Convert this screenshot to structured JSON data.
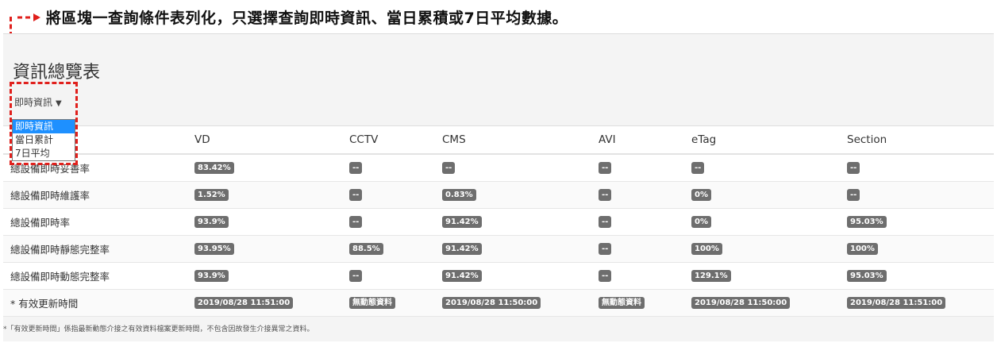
{
  "annotation": {
    "text": "將區塊一查詢條件表列化，只選擇查詢即時資訊、當日累積或7日平均數據。",
    "color": "#e0201c"
  },
  "panel": {
    "title": "資訊總覽表",
    "select": {
      "value": "即時資訊",
      "options": [
        "即時資訊",
        "當日累計",
        "7日平均"
      ]
    }
  },
  "table": {
    "columns": [
      "",
      "VD",
      "CCTV",
      "CMS",
      "AVI",
      "eTag",
      "Section"
    ],
    "rows": [
      {
        "label": "總設備即時妥善率",
        "values": [
          "83.42%",
          "--",
          "--",
          "--",
          "--",
          "--"
        ]
      },
      {
        "label": "總設備即時維護率",
        "values": [
          "1.52%",
          "--",
          "0.83%",
          "--",
          "0%",
          "--"
        ]
      },
      {
        "label": "總設備即時率",
        "values": [
          "93.9%",
          "--",
          "91.42%",
          "--",
          "0%",
          "95.03%"
        ]
      },
      {
        "label": "總設備即時靜態完整率",
        "values": [
          "93.95%",
          "88.5%",
          "91.42%",
          "--",
          "100%",
          "100%"
        ]
      },
      {
        "label": "總設備即時動態完整率",
        "values": [
          "93.9%",
          "--",
          "91.42%",
          "--",
          "129.1%",
          "95.03%"
        ]
      },
      {
        "label": "* 有效更新時間",
        "values": [
          "2019/08/28 11:51:00",
          "無動態資料",
          "2019/08/28 11:50:00",
          "無動態資料",
          "2019/08/28 11:50:00",
          "2019/08/28 11:51:00"
        ]
      }
    ]
  },
  "footnote": "*「有效更新時間」係指最新動態介接之有效資料檔案更新時間，不包含因故發生介接異常之資料。"
}
